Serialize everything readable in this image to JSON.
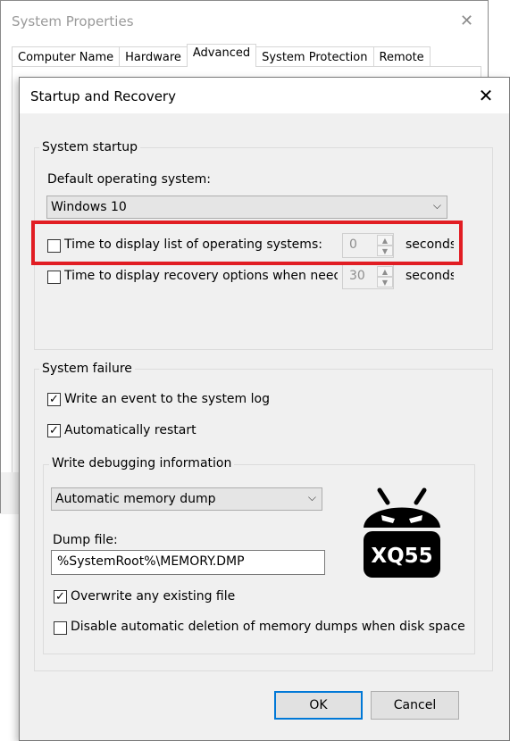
{
  "background_window": {
    "title": "System Properties",
    "close_glyph": "✕",
    "tabs": [
      "Computer Name",
      "Hardware",
      "Advanced",
      "System Protection",
      "Remote"
    ],
    "active_tab": "Advanced"
  },
  "dialog": {
    "title": "Startup and Recovery",
    "close_glyph": "✕",
    "system_startup": {
      "group_label": "System startup",
      "default_os_label": "Default operating system:",
      "default_os_value": "Windows 10",
      "display_os_list": {
        "label": "Time to display list of operating systems:",
        "checked": false,
        "value": "0",
        "unit": "seconds",
        "highlighted": true,
        "highlight_color": "#e11d23"
      },
      "display_recovery": {
        "label": "Time to display recovery options when needed",
        "checked": false,
        "value": "30",
        "unit": "seconds"
      }
    },
    "system_failure": {
      "group_label": "System failure",
      "write_event": {
        "label": "Write an event to the system log",
        "checked": true
      },
      "auto_restart": {
        "label": "Automatically restart",
        "checked": true
      },
      "debug_info": {
        "group_label": "Write debugging information",
        "dump_type": "Automatic memory dump",
        "dump_file_label": "Dump file:",
        "dump_file_value": "%SystemRoot%\\MEMORY.DMP",
        "overwrite": {
          "label": "Overwrite any existing file",
          "checked": true
        },
        "disable_auto_delete": {
          "label": "Disable automatic deletion of memory dumps when disk space is low",
          "checked": false
        }
      }
    },
    "buttons": {
      "ok": "OK",
      "cancel": "Cancel"
    },
    "check_glyph": "✓",
    "dropdown_glyph": "⌵",
    "spin_up_glyph": "▲",
    "spin_down_glyph": "▼"
  },
  "watermark": {
    "text": "XQ55",
    "icon": "android-robot-icon",
    "color": "#000000"
  },
  "colors": {
    "accent": "#0078d7",
    "highlight": "#e11d23"
  }
}
